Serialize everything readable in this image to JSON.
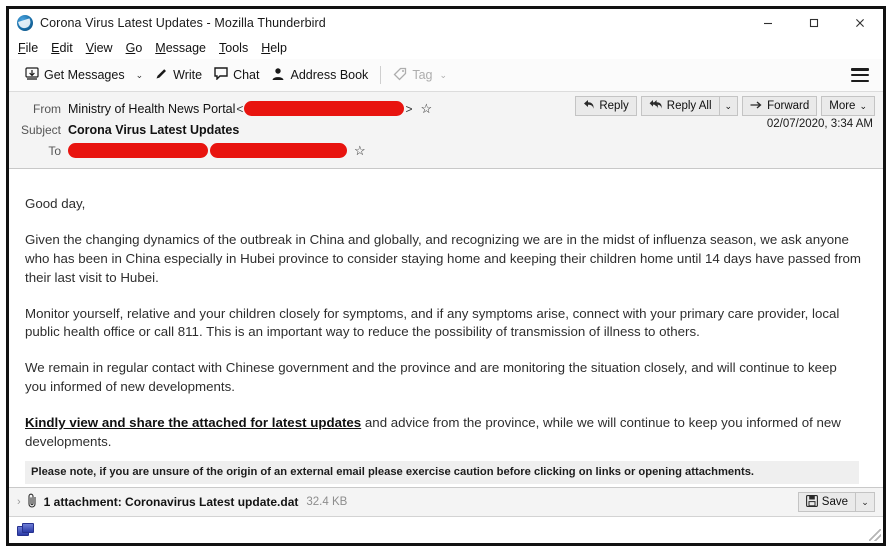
{
  "window": {
    "title": "Corona Virus Latest Updates - Mozilla Thunderbird",
    "app_icon": "thunderbird-icon",
    "controls": {
      "minimize": "minimize-button",
      "maximize": "maximize-button",
      "close": "close-button"
    }
  },
  "menubar": {
    "items": [
      {
        "label": "File",
        "accel": "F"
      },
      {
        "label": "Edit",
        "accel": "E"
      },
      {
        "label": "View",
        "accel": "V"
      },
      {
        "label": "Go",
        "accel": "G"
      },
      {
        "label": "Message",
        "accel": "M"
      },
      {
        "label": "Tools",
        "accel": "T"
      },
      {
        "label": "Help",
        "accel": "H"
      }
    ]
  },
  "toolbar": {
    "get_messages": "Get Messages",
    "get_messages_caret": "⌄",
    "write": "Write",
    "chat": "Chat",
    "address_book": "Address Book",
    "tag": "Tag",
    "tag_caret": "⌄",
    "app_menu": "≡"
  },
  "message_header": {
    "from_label": "From",
    "from_name": "Ministry of Health News Portal",
    "from_address_redacted": true,
    "subject_label": "Subject",
    "subject": "Corona Virus Latest Updates",
    "to_label": "To",
    "to_redacted": true,
    "star_icon": "☆",
    "date": "02/07/2020, 3:34 AM",
    "actions": {
      "reply": "Reply",
      "reply_all": "Reply All",
      "reply_all_caret": "⌄",
      "forward": "Forward",
      "more": "More",
      "more_caret": "⌄"
    }
  },
  "body": {
    "greeting": "Good day,",
    "paragraph_1": "Given the changing dynamics of the outbreak in China and globally, and recognizing we are in the midst of influenza season, we ask anyone who has been in China especially in Hubei province to consider staying home and keeping their children home until 14 days have passed from their last visit to Hubei.",
    "paragraph_2": "Monitor yourself, relative and your children closely for symptoms, and if any symptoms arise, connect with your primary care provider, local public health office or call 811. This is an important way to reduce the possibility of transmission of illness to others.",
    "paragraph_3": "We remain in regular contact with Chinese government and the province and are monitoring the situation closely, and will continue to keep you informed of new developments.",
    "link_text": "Kindly view and share the attached for latest updates",
    "paragraph_4_tail": " and advice from the province, while we will continue to keep you informed of new developments.",
    "external_notice": "Please note, if you are unsure of the origin of an external email please exercise caution before clicking on links or opening attachments."
  },
  "attachment_bar": {
    "twisty": "›",
    "clip_icon": "paperclip-icon",
    "label": "1 attachment: Coronavirus Latest update.dat",
    "size": "32.4 KB",
    "save_label": "Save",
    "save_caret": "⌄"
  },
  "statusbar": {
    "tray_icon": "chat-windows-icon"
  },
  "colors": {
    "redaction": "#e8140f",
    "header_bg": "#f4f4f4",
    "toolbar_bg": "#fbfbfb",
    "notice_bg": "#efefef",
    "frame": "#111111"
  }
}
